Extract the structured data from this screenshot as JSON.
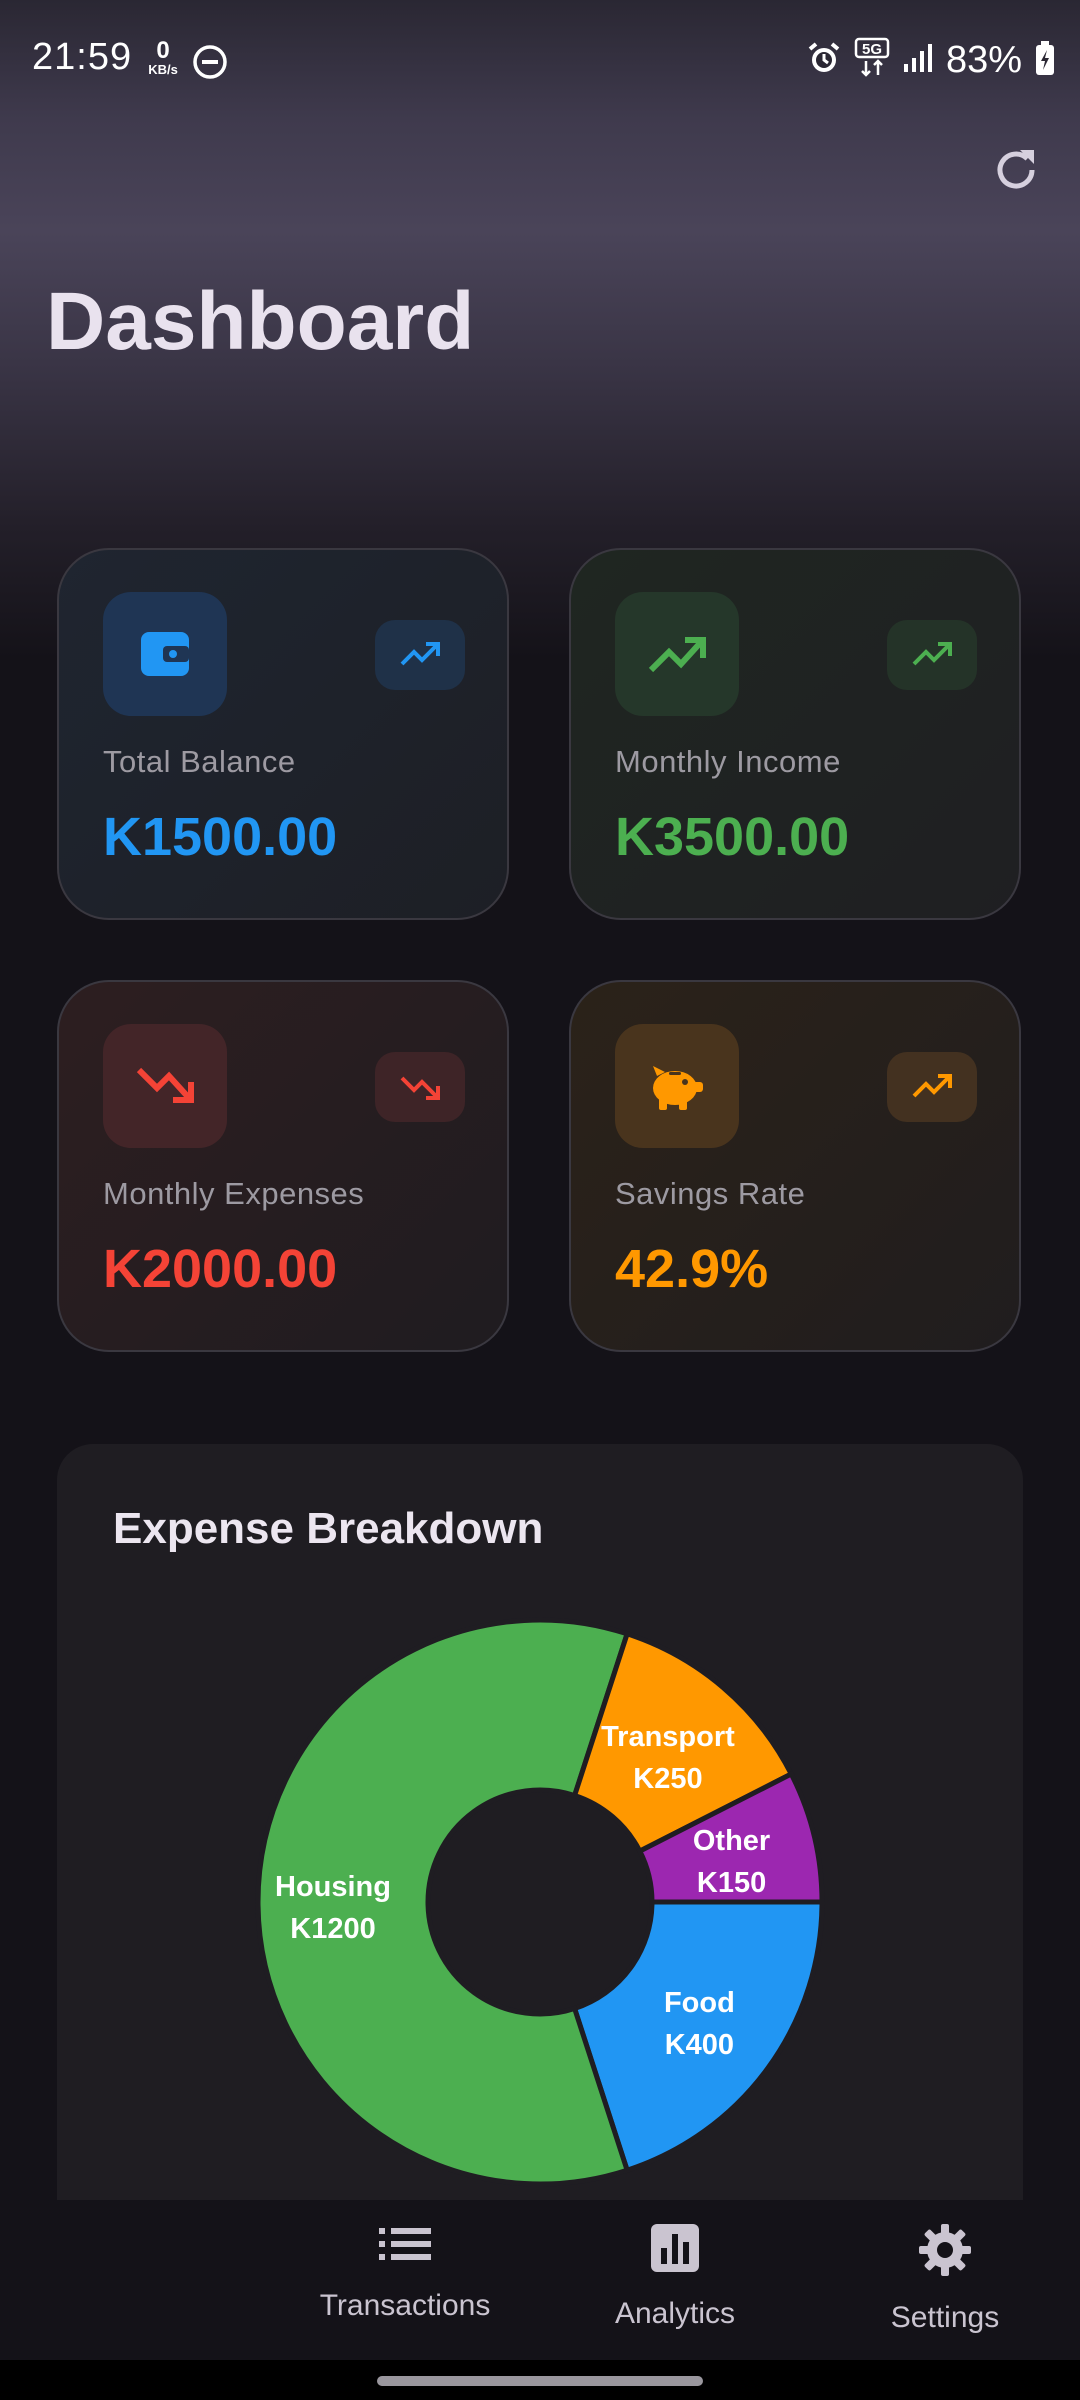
{
  "status_bar": {
    "time": "21:59",
    "net_speed_value": "0",
    "net_speed_unit": "KB/s",
    "icons": [
      "dnd-icon",
      "alarm-icon",
      "5g-icon",
      "signal-icon",
      "battery-icon"
    ],
    "battery": "83%"
  },
  "header": {
    "title": "Dashboard",
    "refresh_icon": "refresh-icon"
  },
  "stats": {
    "total_balance": {
      "label": "Total Balance",
      "value": "K1500.00",
      "color": "#2196f3",
      "icon": "wallet-icon",
      "trend_icon": "trending-up-icon"
    },
    "monthly_income": {
      "label": "Monthly Income",
      "value": "K3500.00",
      "color": "#4caf50",
      "icon": "trending-up-icon",
      "trend_icon": "trending-up-icon"
    },
    "monthly_expenses": {
      "label": "Monthly Expenses",
      "value": "K2000.00",
      "color": "#f44336",
      "icon": "trending-down-icon",
      "trend_icon": "trending-down-icon"
    },
    "savings_rate": {
      "label": "Savings Rate",
      "value": "42.9%",
      "color": "#ff9800",
      "icon": "piggy-bank-icon",
      "trend_icon": "trending-up-icon"
    }
  },
  "breakdown": {
    "title": "Expense Breakdown"
  },
  "chart_data": {
    "type": "pie",
    "donut": true,
    "categories": [
      "Housing",
      "Transport",
      "Other",
      "Food"
    ],
    "values": [
      1200,
      250,
      150,
      400
    ],
    "labels": [
      "K1200",
      "K250",
      "K150",
      "K400"
    ],
    "colors": [
      "#4caf50",
      "#ff9800",
      "#9c27b0",
      "#2196f3"
    ]
  },
  "nav": {
    "items": [
      {
        "label": "Transactions",
        "icon": "list-icon"
      },
      {
        "label": "Analytics",
        "icon": "analytics-icon"
      },
      {
        "label": "Settings",
        "icon": "gear-icon"
      }
    ]
  }
}
